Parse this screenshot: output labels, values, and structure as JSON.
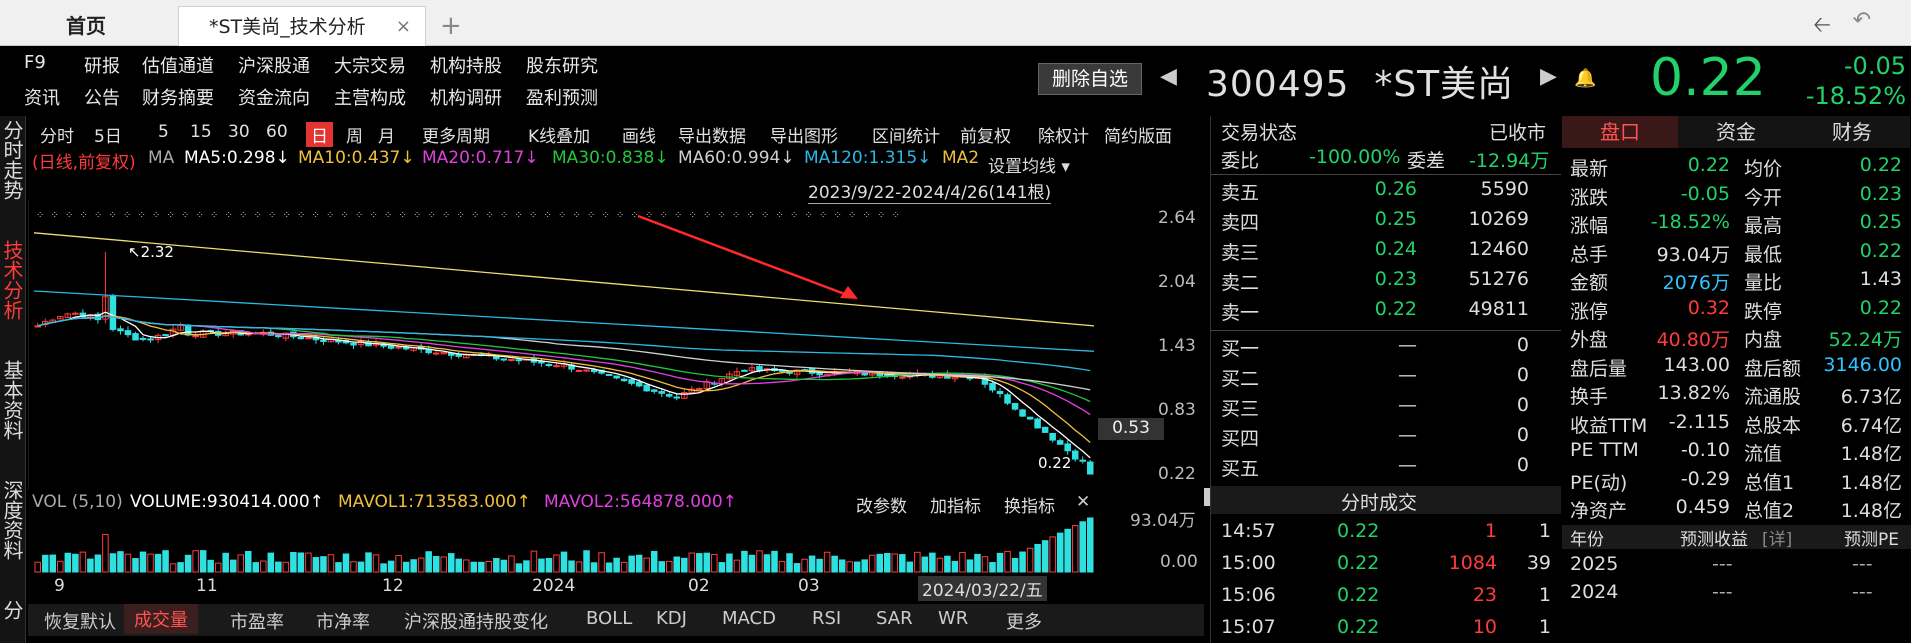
{
  "tabs": {
    "home": "首页",
    "active": "*ST美尚_技术分析",
    "close": "×",
    "plus": "+"
  },
  "menu_row1": [
    "F9",
    "研报",
    "估值通道",
    "沪深股通",
    "大宗交易",
    "机构持股",
    "股东研究"
  ],
  "menu_row2": [
    "资讯",
    "公告",
    "财务摘要",
    "资金流向",
    "主营构成",
    "机构调研",
    "盈利预测"
  ],
  "header": {
    "del_label": "删除自选",
    "code": "300495",
    "name": "*ST美尚",
    "price": "0.22",
    "change": "-0.05",
    "change_pct": "-18.52%"
  },
  "left_nav": [
    "分时走势",
    "技术分析",
    "基本资料",
    "深度资料",
    "分"
  ],
  "chart_toolbar": [
    "分时",
    "5日",
    "5",
    "15",
    "30",
    "60",
    "日",
    "周",
    "月",
    "更多周期",
    "K线叠加",
    "画线",
    "导出数据",
    "导出图形",
    "区间统计",
    "前复权",
    "除权计",
    "简约版面"
  ],
  "ma_legend": {
    "type": "(日线,前复权)",
    "ma": "MA",
    "ma5": "MA5:0.298↓",
    "ma10": "MA10:0.437↓",
    "ma20": "MA20:0.717↓",
    "ma30": "MA30:0.838↓",
    "ma60": "MA60:0.994↓",
    "ma120": "MA120:1.315↓",
    "ma2": "MA2",
    "setting": "设置均线",
    "range": "2023/9/22-2024/4/26(141根)"
  },
  "chart_annotations": {
    "high": "2.32",
    "low": "0.22",
    "cursor_price": "0.53"
  },
  "price_axis": [
    "2.64",
    "2.04",
    "1.43",
    "0.83",
    "0.22"
  ],
  "vol": {
    "title": "VOL (5,10)",
    "volume": "VOLUME:930414.000↑",
    "mavol1": "MAVOL1:713583.000↑",
    "mavol2": "MAVOL2:564878.000↑",
    "btn1": "改参数",
    "btn2": "加指标",
    "btn3": "换指标",
    "axis_top": "93.04万",
    "axis_bottom": "0.00"
  },
  "date_axis": [
    "9",
    "11",
    "12",
    "2024",
    "02",
    "03",
    "2024/03/22/五"
  ],
  "bottom_tabs": [
    "恢复默认",
    "成交量",
    "市盈率",
    "市净率",
    "沪深股通持股变化",
    "BOLL",
    "KDJ",
    "MACD",
    "RSI",
    "SAR",
    "WR",
    "更多"
  ],
  "order_book": {
    "status_label": "交易状态",
    "status": "已收市",
    "wb_label": "委比",
    "wb": "-100.00%",
    "wc_label": "委差",
    "wc": "-12.94万",
    "asks": [
      {
        "label": "卖五",
        "price": "0.26",
        "vol": "5590"
      },
      {
        "label": "卖四",
        "price": "0.25",
        "vol": "10269"
      },
      {
        "label": "卖三",
        "price": "0.24",
        "vol": "12460"
      },
      {
        "label": "卖二",
        "price": "0.23",
        "vol": "51276"
      },
      {
        "label": "卖一",
        "price": "0.22",
        "vol": "49811"
      }
    ],
    "bids": [
      {
        "label": "买一",
        "price": "—",
        "vol": "0"
      },
      {
        "label": "买二",
        "price": "—",
        "vol": "0"
      },
      {
        "label": "买三",
        "price": "—",
        "vol": "0"
      },
      {
        "label": "买四",
        "price": "—",
        "vol": "0"
      },
      {
        "label": "买五",
        "price": "—",
        "vol": "0"
      }
    ],
    "ticks_title": "分时成交",
    "ticks": [
      {
        "time": "14:57",
        "price": "0.22",
        "vol": "1",
        "n": "1"
      },
      {
        "time": "15:00",
        "price": "0.22",
        "vol": "1084",
        "n": "39"
      },
      {
        "time": "15:06",
        "price": "0.22",
        "vol": "23",
        "n": "1"
      },
      {
        "time": "15:07",
        "price": "0.22",
        "vol": "10",
        "n": "1"
      }
    ]
  },
  "quote_tabs": [
    "盘口",
    "资金",
    "财务"
  ],
  "quote": [
    {
      "l1": "最新",
      "v1": "0.22",
      "c1": "#22d16a",
      "l2": "均价",
      "v2": "0.22",
      "c2": "#22d16a"
    },
    {
      "l1": "涨跌",
      "v1": "-0.05",
      "c1": "#22d16a",
      "l2": "今开",
      "v2": "0.23",
      "c2": "#22d16a"
    },
    {
      "l1": "涨幅",
      "v1": "-18.52%",
      "c1": "#22d16a",
      "l2": "最高",
      "v2": "0.25",
      "c2": "#22d16a"
    },
    {
      "l1": "总手",
      "v1": "93.04万",
      "c1": "#dddddd",
      "l2": "最低",
      "v2": "0.22",
      "c2": "#22d16a"
    },
    {
      "l1": "金额",
      "v1": "2076万",
      "c1": "#2cc4ff",
      "l2": "量比",
      "v2": "1.43",
      "c2": "#dddddd"
    },
    {
      "l1": "涨停",
      "v1": "0.32",
      "c1": "#ff3b3b",
      "l2": "跌停",
      "v2": "0.22",
      "c2": "#22d16a"
    },
    {
      "l1": "外盘",
      "v1": "40.80万",
      "c1": "#ff3b3b",
      "l2": "内盘",
      "v2": "52.24万",
      "c2": "#22d16a"
    },
    {
      "l1": "盘后量",
      "v1": "143.00",
      "c1": "#dddddd",
      "l2": "盘后额",
      "v2": "3146.00",
      "c2": "#2cc4ff"
    },
    {
      "l1": "换手",
      "v1": "13.82%",
      "c1": "#dddddd",
      "l2": "流通股",
      "v2": "6.73亿",
      "c2": "#dddddd"
    },
    {
      "l1": "收益TTM",
      "v1": "-2.115",
      "c1": "#dddddd",
      "l2": "总股本",
      "v2": "6.74亿",
      "c2": "#dddddd"
    },
    {
      "l1": "PE TTM",
      "v1": "-0.10",
      "c1": "#dddddd",
      "l2": "流值",
      "v2": "1.48亿",
      "c2": "#dddddd"
    },
    {
      "l1": "PE(动)",
      "v1": "-0.29",
      "c1": "#dddddd",
      "l2": "总值1",
      "v2": "1.48亿",
      "c2": "#dddddd"
    },
    {
      "l1": "净资产",
      "v1": "0.459",
      "c1": "#dddddd",
      "l2": "总值2",
      "v2": "1.48亿",
      "c2": "#dddddd"
    }
  ],
  "forecast": {
    "h1": "年份",
    "h2": "预测收益",
    "h2b": "[详]",
    "h3": "预测PE",
    "rows": [
      {
        "year": "2025",
        "eps": "---",
        "pe": "---"
      },
      {
        "year": "2024",
        "eps": "---",
        "pe": "---"
      }
    ]
  },
  "colors": {
    "up": "#ff3b3b",
    "down": "#22d16a",
    "ma5": "#ffffff",
    "ma10": "#f0c03a",
    "ma20": "#e040e0",
    "ma30": "#22c83c",
    "ma60": "#cfcfcf",
    "ma120": "#2ab8e8"
  }
}
